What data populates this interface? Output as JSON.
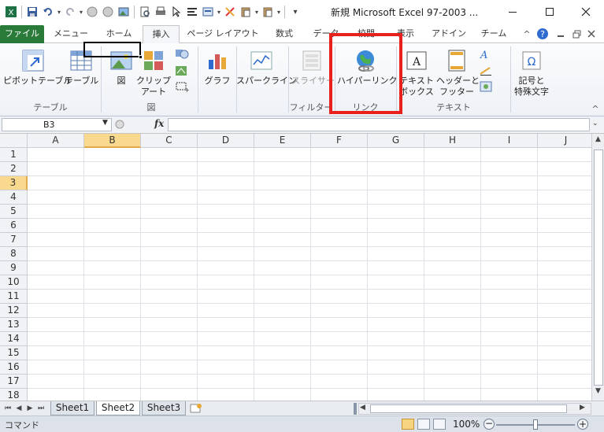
{
  "window": {
    "title": "新規 Microsoft Excel 97-2003 ...",
    "minimize_icon": "minimize-icon",
    "maximize_icon": "maximize-icon",
    "close_icon": "close-icon"
  },
  "quick_access": [
    "excel-logo-icon",
    "save-icon",
    "undo-icon",
    "redo-icon",
    "circle-icon",
    "circle-icon",
    "picture-icon",
    "print-preview-icon",
    "print-icon",
    "pointer-icon",
    "align-icon",
    "form-icon",
    "eraser-icon",
    "paste-icon",
    "paste-special-icon",
    "customize-icon"
  ],
  "ribbon_tabs": [
    {
      "label": "ファイル",
      "kind": "file"
    },
    {
      "label": "メニュー"
    },
    {
      "label": "ホーム"
    },
    {
      "label": "挿入",
      "active": true
    },
    {
      "label": "ページ レイアウト"
    },
    {
      "label": "数式"
    },
    {
      "label": "データ"
    },
    {
      "label": "校閲"
    },
    {
      "label": "表示"
    },
    {
      "label": "アドイン"
    },
    {
      "label": "チーム"
    }
  ],
  "ribbon": {
    "pivot_table": "ピボットテーブル",
    "table": "テーブル",
    "group_table": "テーブル",
    "picture": "図",
    "clip_art_1": "クリップ",
    "clip_art_2": "アート",
    "group_figure": "図",
    "chart": "グラフ",
    "sparkline": "スパークライン",
    "slicer": "スライサー",
    "group_filter": "フィルター",
    "hyperlink": "ハイパーリンク",
    "group_link": "リンク",
    "textbox_1": "テキスト",
    "textbox_2": "ボックス",
    "header_footer_1": "ヘッダーと",
    "header_footer_2": "フッター",
    "group_text": "テキスト",
    "symbol_1": "記号と",
    "symbol_2": "特殊文字"
  },
  "formula_bar": {
    "name_box": "B3",
    "fx_label": "fx",
    "formula": ""
  },
  "columns": [
    "A",
    "B",
    "C",
    "D",
    "E",
    "F",
    "G",
    "H",
    "I",
    "J"
  ],
  "rows": [
    "1",
    "2",
    "3",
    "4",
    "5",
    "6",
    "7",
    "8",
    "9",
    "10",
    "11",
    "12",
    "13",
    "14",
    "15",
    "16",
    "17",
    "18"
  ],
  "selected_cell": "B3",
  "sheets": [
    {
      "label": "Sheet1"
    },
    {
      "label": "Sheet2",
      "active": true
    },
    {
      "label": "Sheet3"
    }
  ],
  "status": {
    "mode": "コマンド",
    "zoom": "100%"
  },
  "colors": {
    "file_tab": "#2a7a3a",
    "highlight": "#e8211d",
    "selected_header": "#f9d98e"
  }
}
